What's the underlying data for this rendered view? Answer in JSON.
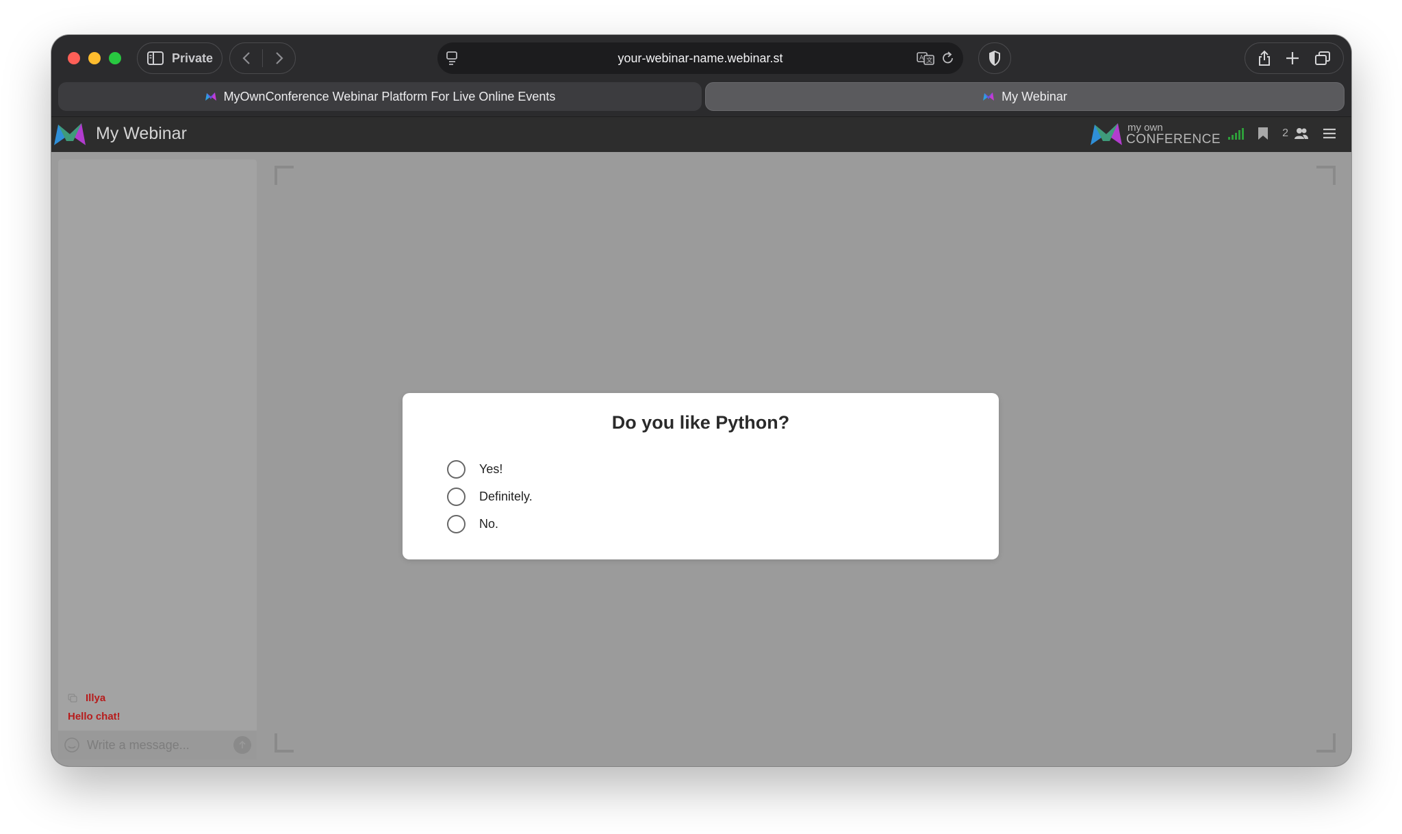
{
  "browser": {
    "private_label": "Private",
    "url": "your-webinar-name.webinar.st",
    "tabs": [
      {
        "label": "MyOwnConference Webinar Platform For Live Online Events"
      },
      {
        "label": "My Webinar"
      }
    ]
  },
  "app": {
    "title": "My Webinar",
    "brand_line1": "my own",
    "brand_line2": "CONFERENCE",
    "participant_count": "2"
  },
  "chat": {
    "user": "Illya",
    "message": "Hello chat!",
    "input_placeholder": "Write a message..."
  },
  "poll": {
    "question": "Do you like Python?",
    "options": [
      {
        "label": "Yes!"
      },
      {
        "label": "Definitely."
      },
      {
        "label": "No."
      }
    ]
  },
  "colors": {
    "chat_accent": "#b71c1c",
    "signal_green": "#2e9e3a",
    "stage_gray": "#9b9b9b"
  }
}
